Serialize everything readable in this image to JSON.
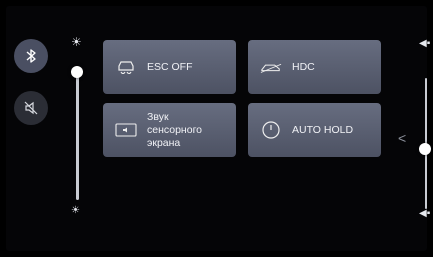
{
  "left_buttons": {
    "bluetooth": "bluetooth-icon",
    "mute": "speaker-muted-icon"
  },
  "tiles": {
    "esc": {
      "label": "ESC OFF",
      "icon": "esc-off-icon"
    },
    "hdc": {
      "label": "HDC",
      "icon": "hdc-icon"
    },
    "sound": {
      "label": "Звук сенсорного экрана",
      "icon": "touch-sound-icon"
    },
    "autohold": {
      "label": "AUTO HOLD",
      "icon": "auto-hold-icon"
    }
  },
  "brightness": {
    "level": 0.97,
    "icon_top": "sun-icon",
    "icon_bottom": "sun-small-icon"
  },
  "volume": {
    "level": 0.5,
    "icon_top": "speaker-icon",
    "icon_bottom": "speaker-low-icon"
  },
  "panel_toggle": "chevron-left-icon",
  "colors": {
    "tile": "#5a5f71",
    "bt_button": "#4a4f62",
    "background": "#000000"
  }
}
